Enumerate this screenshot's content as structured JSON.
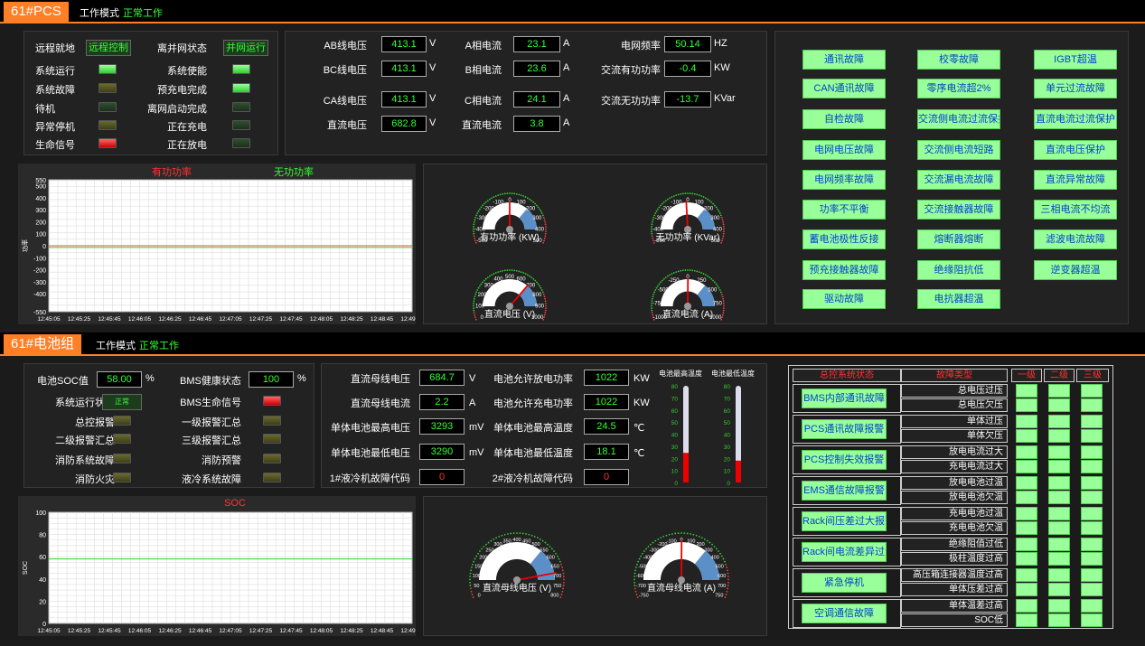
{
  "pcs": {
    "title": "61#PCS",
    "mode_label": "工作模式",
    "mode_value": "正常工作"
  },
  "status_left": [
    {
      "label": "远程就地",
      "type": "btn",
      "value": "远程控制"
    },
    {
      "label": "系统运行",
      "type": "led",
      "state": "on"
    },
    {
      "label": "系统故障",
      "type": "led",
      "state": "off"
    },
    {
      "label": "待机",
      "type": "led",
      "state": "doff"
    },
    {
      "label": "异常停机",
      "type": "led",
      "state": "off"
    },
    {
      "label": "生命信号",
      "type": "led",
      "state": "red"
    }
  ],
  "status_right": [
    {
      "label": "离并网状态",
      "type": "btn",
      "value": "并网运行"
    },
    {
      "label": "系统使能",
      "type": "led",
      "state": "on"
    },
    {
      "label": "预充电完成",
      "type": "led",
      "state": "on"
    },
    {
      "label": "离网启动完成",
      "type": "led",
      "state": "doff"
    },
    {
      "label": "正在充电",
      "type": "led",
      "state": "doff"
    },
    {
      "label": "正在放电",
      "type": "led",
      "state": "doff"
    }
  ],
  "meas": [
    {
      "label": "AB线电压",
      "value": "413.1",
      "unit": "V"
    },
    {
      "label": "BC线电压",
      "value": "413.1",
      "unit": "V"
    },
    {
      "label": "CA线电压",
      "value": "413.1",
      "unit": "V"
    },
    {
      "label": "直流电压",
      "value": "682.8",
      "unit": "V"
    },
    {
      "label": "A相电流",
      "value": "23.1",
      "unit": "A"
    },
    {
      "label": "B相电流",
      "value": "23.6",
      "unit": "A"
    },
    {
      "label": "C相电流",
      "value": "24.1",
      "unit": "A"
    },
    {
      "label": "直流电流",
      "value": "3.8",
      "unit": "A"
    },
    {
      "label": "电网频率",
      "value": "50.14",
      "unit": "HZ"
    },
    {
      "label": "交流有功功率",
      "value": "-0.4",
      "unit": "KW"
    },
    {
      "label": "交流无功功率",
      "value": "-13.7",
      "unit": "KVar"
    }
  ],
  "faults": [
    "通讯故障",
    "校零故障",
    "IGBT超温",
    "CAN通讯故障",
    "零序电流超2%",
    "单元过流故障",
    "自检故障",
    "交流侧电流过流保护",
    "直流电流过流保护",
    "电网电压故障",
    "交流侧电流短路",
    "直流电压保护",
    "电网频率故障",
    "交流漏电流故障",
    "直流异常故障",
    "功率不平衡",
    "交流接触器故障",
    "三相电流不均流",
    "蓄电池极性反接",
    "熔断器熔断",
    "滤波电流故障",
    "预充接触器故障",
    "绝缘阻抗低",
    "逆变器超温",
    "驱动故障",
    "电抗器超温"
  ],
  "gauges_pcs": [
    {
      "title": "有功功率 (KW)",
      "min": -500,
      "max": 500,
      "value": -0.4,
      "ticks": [
        "-500",
        "-400",
        "-300",
        "-200",
        "-100",
        "0",
        "100",
        "200",
        "300",
        "400",
        "500"
      ]
    },
    {
      "title": "无功功率 (KVar)",
      "min": -500,
      "max": 500,
      "value": -13.7,
      "ticks": [
        "-500",
        "-400",
        "-300",
        "-200",
        "-100",
        "0",
        "100",
        "200",
        "300",
        "400",
        "500"
      ]
    },
    {
      "title": "直流电压 (V)",
      "min": 0,
      "max": 1000,
      "value": 682.8,
      "ticks": [
        "0",
        "100",
        "200",
        "300",
        "400",
        "500",
        "600",
        "700",
        "800",
        "900",
        "1000"
      ]
    },
    {
      "title": "直流电流 (A)",
      "min": -1000,
      "max": 1000,
      "value": 3.8,
      "ticks": [
        "-1000",
        "-750",
        "-500",
        "-250",
        "0",
        "250",
        "500",
        "750",
        "1000"
      ]
    }
  ],
  "bat": {
    "title": "61#电池组",
    "mode_label": "工作模式",
    "mode_value": "正常工作"
  },
  "bat_left": [
    {
      "label": "系统运行状态",
      "type": "btn",
      "value": "正常"
    },
    {
      "label": "总控报警",
      "type": "led",
      "state": "off"
    },
    {
      "label": "二级报警汇总",
      "type": "led",
      "state": "off"
    },
    {
      "label": "消防系统故障",
      "type": "led",
      "state": "off"
    },
    {
      "label": "消防火灾",
      "type": "led",
      "state": "off"
    }
  ],
  "bat_right": [
    {
      "label": "BMS生命信号",
      "type": "led",
      "state": "red"
    },
    {
      "label": "一级报警汇总",
      "type": "led",
      "state": "off"
    },
    {
      "label": "三级报警汇总",
      "type": "led",
      "state": "off"
    },
    {
      "label": "消防预警",
      "type": "led",
      "state": "off"
    },
    {
      "label": "液冷系统故障",
      "type": "led",
      "state": "off"
    }
  ],
  "soc": {
    "label": "电池SOC值",
    "value": "58.00",
    "unit": "%"
  },
  "bms_health": {
    "label": "BMS健康状态",
    "value": "100",
    "unit": "%"
  },
  "bat_meas": [
    {
      "label": "直流母线电压",
      "value": "684.7",
      "unit": "V"
    },
    {
      "label": "直流母线电流",
      "value": "2.2",
      "unit": "A"
    },
    {
      "label": "单体电池最高电压",
      "value": "3293",
      "unit": "mV"
    },
    {
      "label": "单体电池最低电压",
      "value": "3290",
      "unit": "mV"
    },
    {
      "label": "1#液冷机故障代码",
      "value": "0",
      "unit": ""
    },
    {
      "label": "电池允许放电功率",
      "value": "1022",
      "unit": "KW"
    },
    {
      "label": "电池允许充电功率",
      "value": "1022",
      "unit": "KW"
    },
    {
      "label": "单体电池最高温度",
      "value": "24.5",
      "unit": "℃"
    },
    {
      "label": "单体电池最低温度",
      "value": "18.1",
      "unit": "℃"
    },
    {
      "label": "2#液冷机故障代码",
      "value": "0",
      "unit": ""
    }
  ],
  "thermo": [
    {
      "title": "电池最高温度",
      "value": 24.5,
      "max": 80,
      "ticks": [
        "80",
        "70",
        "60",
        "50",
        "40",
        "30",
        "20",
        "10",
        "0"
      ]
    },
    {
      "title": "电池最低温度",
      "value": 18.1,
      "max": 80,
      "ticks": [
        "80",
        "70",
        "60",
        "50",
        "40",
        "30",
        "20",
        "10",
        "0"
      ]
    }
  ],
  "gauges_bat": [
    {
      "title": "直流母线电压 (V)",
      "min": 0,
      "max": 800,
      "value": 684.7,
      "ticks": [
        "0",
        "50",
        "100",
        "150",
        "200",
        "250",
        "300",
        "350",
        "400",
        "450",
        "500",
        "550",
        "600",
        "650",
        "700",
        "750",
        "800"
      ]
    },
    {
      "title": "直流母线电流 (A)",
      "min": -750,
      "max": 750,
      "value": 2.2,
      "ticks": [
        "-750",
        "-700",
        "-600",
        "-500",
        "-400",
        "-300",
        "-200",
        "-100",
        "0",
        "100",
        "200",
        "300",
        "400",
        "500",
        "600",
        "700",
        "750"
      ]
    }
  ],
  "alarm_table": {
    "headers": [
      "总控系统状态",
      "故障类型",
      "一级",
      "二级",
      "三级"
    ],
    "groups": [
      {
        "btn": "BMS内部通讯故障",
        "rows": [
          "总电压过压",
          "总电压欠压"
        ]
      },
      {
        "btn": "PCS通讯故障报警",
        "rows": [
          "单体过压",
          "单体欠压"
        ]
      },
      {
        "btn": "PCS控制失效报警",
        "rows": [
          "放电电流过大",
          "充电电流过大"
        ]
      },
      {
        "btn": "EMS通信故障报警",
        "rows": [
          "放电电池过温",
          "放电电池欠温"
        ]
      },
      {
        "btn": "Rack间压差过大报警",
        "rows": [
          "充电电池过温",
          "充电电池欠温"
        ]
      },
      {
        "btn": "Rack间电流差异过大",
        "rows": [
          "绝缘阻值过低",
          "极柱温度过高"
        ]
      },
      {
        "btn": "紧急停机",
        "rows": [
          "高压箱连接器温度过高",
          "单体压差过高"
        ]
      },
      {
        "btn": "空调通信故障",
        "rows": [
          "单体温差过高",
          "SOC低"
        ]
      }
    ]
  },
  "chart_power": {
    "type": "line",
    "legend": [
      "有功功率",
      "无功功率"
    ],
    "ylabel": "功率",
    "ylim": [
      -550,
      550
    ],
    "yticks": [
      "550",
      "500",
      "400",
      "300",
      "200",
      "100",
      "0",
      "-100",
      "-200",
      "-300",
      "-400",
      "-550"
    ],
    "x": [
      "12:45:05",
      "12:45:25",
      "12:45:45",
      "12:46:05",
      "12:46:25",
      "12:46:45",
      "12:47:05",
      "12:47:25",
      "12:47:45",
      "12:48:05",
      "12:48:25",
      "12:48:45",
      "12:49:04"
    ],
    "series": [
      {
        "name": "有功功率",
        "values": [
          0,
          0,
          0,
          0,
          0,
          0,
          0,
          0,
          0,
          0,
          0,
          0,
          0
        ]
      },
      {
        "name": "无功功率",
        "values": [
          -13.7,
          -13.7,
          -13.7,
          -13.7,
          -13.7,
          -13.7,
          -13.7,
          -13.7,
          -13.7,
          -13.7,
          -13.7,
          -13.7,
          -13.7
        ]
      }
    ]
  },
  "chart_soc": {
    "type": "line",
    "title": "SOC",
    "ylabel": "SOC",
    "ylim": [
      0,
      100
    ],
    "yticks": [
      "100",
      "80",
      "60",
      "40",
      "20",
      "0"
    ],
    "x": [
      "12:45:05",
      "12:45:25",
      "12:45:45",
      "12:46:05",
      "12:46:25",
      "12:46:45",
      "12:47:05",
      "12:47:25",
      "12:47:45",
      "12:48:05",
      "12:48:25",
      "12:48:45",
      "12:49:04"
    ],
    "series": [
      {
        "name": "SOC",
        "values": [
          58,
          58,
          58,
          58,
          58,
          58,
          58,
          58,
          58,
          58,
          58,
          58,
          58
        ]
      }
    ]
  }
}
